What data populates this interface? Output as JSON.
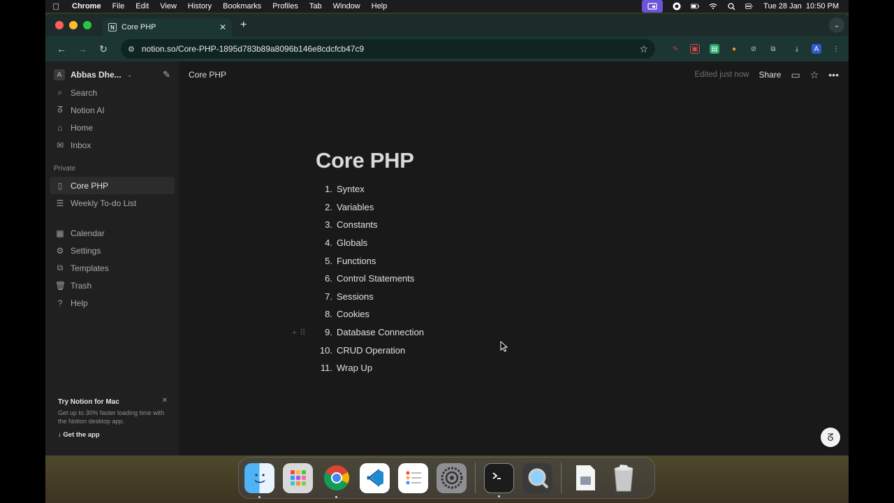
{
  "menubar": {
    "app_name": "Chrome",
    "menus": [
      "File",
      "Edit",
      "View",
      "History",
      "Bookmarks",
      "Profiles",
      "Tab",
      "Window",
      "Help"
    ],
    "datetime": "Tue 28 Jan  10:50 PM"
  },
  "browser": {
    "tab_title": "Core PHP",
    "url": "notion.so/Core-PHP-1895d783b89a8096b146e8cdcfcb47c9",
    "profile_initial": "A"
  },
  "sidebar": {
    "workspace_initial": "A",
    "workspace_name": "Abbas Dhe...",
    "top_items": [
      {
        "label": "Search",
        "icon": "search-icon"
      },
      {
        "label": "Notion AI",
        "icon": "notion-ai-icon"
      },
      {
        "label": "Home",
        "icon": "home-icon"
      },
      {
        "label": "Inbox",
        "icon": "inbox-icon"
      }
    ],
    "private_label": "Private",
    "pages": [
      {
        "label": "Core PHP",
        "icon": "page-icon",
        "active": true
      },
      {
        "label": "Weekly To-do List",
        "icon": "list-icon",
        "active": false
      }
    ],
    "bottom_items": [
      {
        "label": "Calendar",
        "icon": "calendar-icon"
      },
      {
        "label": "Settings",
        "icon": "gear-icon"
      },
      {
        "label": "Templates",
        "icon": "templates-icon"
      },
      {
        "label": "Trash",
        "icon": "trash-icon"
      },
      {
        "label": "Help",
        "icon": "help-icon"
      }
    ],
    "promo": {
      "title": "Try Notion for Mac",
      "description": "Get up to 30% faster loading time with the Notion desktop app.",
      "cta": "Get the app"
    }
  },
  "topbar": {
    "breadcrumb": "Core PHP",
    "edited": "Edited just now",
    "share": "Share"
  },
  "page": {
    "title": "Core PHP",
    "items": [
      {
        "num": "1.",
        "text": "Syntex"
      },
      {
        "num": "2.",
        "text": "Variables"
      },
      {
        "num": "3.",
        "text": "Constants"
      },
      {
        "num": "4.",
        "text": "Globals"
      },
      {
        "num": "5.",
        "text": "Functions"
      },
      {
        "num": "6.",
        "text": "Control Statements"
      },
      {
        "num": "7.",
        "text": "Sessions"
      },
      {
        "num": "8.",
        "text": "Cookies"
      },
      {
        "num": "9.",
        "text": "Database Connection"
      },
      {
        "num": "10.",
        "text": "CRUD Operation"
      },
      {
        "num": "11.",
        "text": "Wrap Up"
      }
    ]
  },
  "dock": [
    "Finder",
    "Launchpad",
    "Google Chrome",
    "Visual Studio Code",
    "Reminders",
    "System Settings",
    "Terminal",
    "QuickTime Player",
    "Preview",
    "Trash"
  ]
}
